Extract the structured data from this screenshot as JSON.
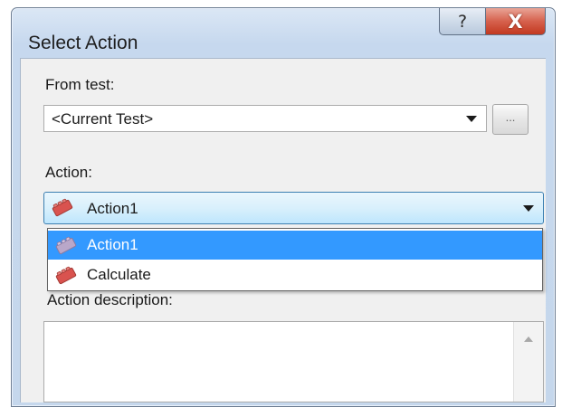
{
  "window": {
    "title": "Select Action",
    "help_symbol": "?",
    "close_symbol": "X"
  },
  "from_test": {
    "label": "From test:",
    "value": "<Current Test>",
    "browse_label": "..."
  },
  "action": {
    "label": "Action:",
    "selected": "Action1",
    "options": [
      {
        "label": "Action1",
        "icon": "action-block-icon"
      },
      {
        "label": "Calculate",
        "icon": "action-block-icon"
      }
    ]
  },
  "description": {
    "label": "Action description:",
    "value": ""
  },
  "colors": {
    "highlight": "#3399ff",
    "action_icon": "#d9534f"
  }
}
